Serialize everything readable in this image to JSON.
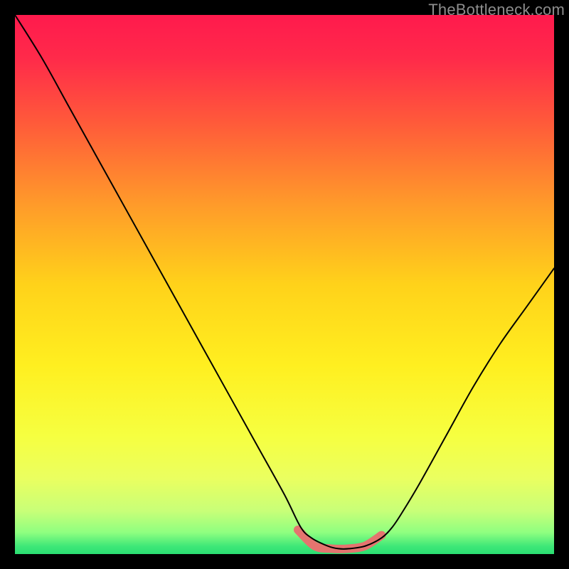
{
  "watermark": "TheBottleneck.com",
  "chart_data": {
    "type": "line",
    "title": "",
    "xlabel": "",
    "ylabel": "",
    "xlim": [
      0,
      100
    ],
    "ylim": [
      0,
      100
    ],
    "grid": false,
    "legend": false,
    "series": [
      {
        "name": "curve",
        "color": "#000000",
        "x": [
          0,
          5,
          10,
          15,
          20,
          25,
          30,
          35,
          40,
          45,
          50,
          53,
          55,
          58,
          60,
          62,
          65,
          68,
          70,
          72,
          75,
          80,
          85,
          90,
          95,
          100
        ],
        "values": [
          100,
          92,
          83,
          74,
          65,
          56,
          47,
          38,
          29,
          20,
          11,
          5,
          3,
          1.5,
          1,
          1,
          1.5,
          3,
          5,
          8,
          13,
          22,
          31,
          39,
          46,
          53
        ]
      }
    ],
    "highlight": {
      "name": "bottom-highlight",
      "color": "#e4746f",
      "thickness_px": 12,
      "x_range": [
        52.5,
        68
      ],
      "y_percent": [
        4.5,
        1.5,
        1,
        1,
        1.5,
        3.5
      ]
    },
    "gradient_stops": [
      {
        "offset": 0.0,
        "color": "#ff1a4d"
      },
      {
        "offset": 0.08,
        "color": "#ff2a4a"
      },
      {
        "offset": 0.2,
        "color": "#ff5a3a"
      },
      {
        "offset": 0.35,
        "color": "#ff9a2a"
      },
      {
        "offset": 0.5,
        "color": "#ffd21a"
      },
      {
        "offset": 0.65,
        "color": "#ffef20"
      },
      {
        "offset": 0.78,
        "color": "#f6ff40"
      },
      {
        "offset": 0.86,
        "color": "#eaff60"
      },
      {
        "offset": 0.92,
        "color": "#c8ff78"
      },
      {
        "offset": 0.96,
        "color": "#8fff80"
      },
      {
        "offset": 0.985,
        "color": "#40e878"
      },
      {
        "offset": 1.0,
        "color": "#2adf72"
      }
    ]
  }
}
